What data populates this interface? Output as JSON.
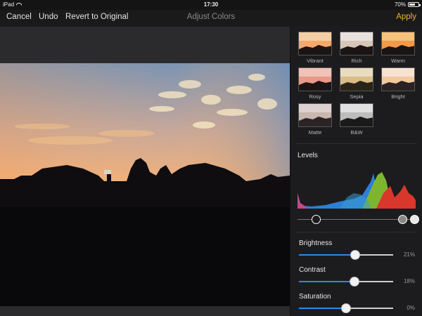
{
  "status_bar": {
    "device": "iPad",
    "time": "17:30",
    "battery": "70%",
    "battery_level": 0.7
  },
  "toolbar": {
    "cancel": "Cancel",
    "undo": "Undo",
    "revert": "Revert to Original",
    "title": "Adjust Colors",
    "apply": "Apply",
    "apply_color": "#f0b429"
  },
  "presets": [
    {
      "label": "Vibrant"
    },
    {
      "label": "Rich"
    },
    {
      "label": "Warm"
    },
    {
      "label": "Rosy"
    },
    {
      "label": "Sepia"
    },
    {
      "label": "Bright"
    },
    {
      "label": "Matte"
    },
    {
      "label": "B&W"
    }
  ],
  "levels": {
    "title": "Levels",
    "black_point": 0.16,
    "gray_point": 0.89,
    "white_point": 0.99
  },
  "sliders": [
    {
      "label": "Brightness",
      "value": "21%",
      "level": 0.6
    },
    {
      "label": "Contrast",
      "value": "18%",
      "level": 0.59
    },
    {
      "label": "Saturation",
      "value": "0%",
      "level": 0.5
    }
  ],
  "accent_color": "#2f88e6"
}
